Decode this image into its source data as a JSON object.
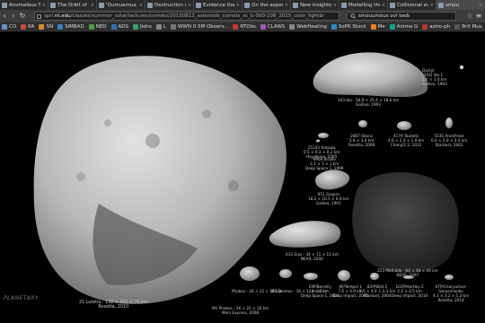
{
  "tabs": [
    {
      "label": "Anomalous T"
    },
    {
      "label": "The Orbit of"
    },
    {
      "label": "'Oumuamua"
    },
    {
      "label": "Destruction o"
    },
    {
      "label": "Evidence that"
    },
    {
      "label": "On the aspect"
    },
    {
      "label": "New insights"
    },
    {
      "label": "Modelling the"
    },
    {
      "label": "Collisional ev"
    },
    {
      "label": "smou"
    }
  ],
  "navbar": {
    "url_prefix": "sprl",
    "url_host": "nt.edu",
    "url_path": "/classes/summer_solar/lectures/comets/20150813_asteroids_comets_sc_b-000-108_2015_color_lightbr",
    "search": "smouumous ovi loeb"
  },
  "bookmarks": [
    {
      "label": "CO",
      "color": "#6a8fc7"
    },
    {
      "label": "KA",
      "color": "#c94a3a"
    },
    {
      "label": "SN",
      "color": "#d18a2f"
    },
    {
      "label": "SIMBAD",
      "color": "#3b7fc4"
    },
    {
      "label": "NED",
      "color": "#4a9a4a"
    },
    {
      "label": "ADS",
      "color": "#2f6fb4"
    },
    {
      "label": "Jisho",
      "color": "#3aa06a"
    },
    {
      "label": "L",
      "color": "#888888"
    },
    {
      "label": "WWN 0.5M Observ...",
      "color": "#777777"
    },
    {
      "label": "RTObs",
      "color": "#c0392b"
    },
    {
      "label": "CLAWS",
      "color": "#9b59b6"
    },
    {
      "label": "WebHeating",
      "color": "#888888"
    },
    {
      "label": "SoPK Stock",
      "color": "#2e86c1"
    },
    {
      "label": "Me",
      "color": "#e67e22"
    },
    {
      "label": "Anime G",
      "color": "#16a085"
    },
    {
      "label": "astro-ph",
      "color": "#b03a2e"
    },
    {
      "label": "Brit Mus",
      "color": "#555555"
    }
  ],
  "captions": {
    "lutetia": "21 Lutetia - 132 × 101 × 76 km\nRosetta, 2010",
    "dactyl": "Dactyl\n(243) Ida 1\n1.6 × 1.4 km\nGalileo, 1993",
    "ida": "243 Ida - 58.8 × 25.4 × 18.6 km\nGalileo, 1993",
    "itokawa": "25143 Itokawa\n0.5 × 0.3 × 0.2 km\nHayabusa, 2005",
    "braille": "9969 Braille\n2.1 × 1 × 1 km\nDeep Space 1, 1999",
    "steins": "2867 Šteins\n5.9 × 4.0 km\nRosetta, 2008",
    "toutatis": "4179 Toutatis\n4.6 × 2.4 × 1.9 km\nChang'E 2, 2012",
    "annefrank": "5535 Annefrank\n6.6 × 5.0 × 3.4 km\nStardust, 2002",
    "gaspra": "951 Gaspra\n18.2 × 10.5 × 8.9 km\nGalileo, 1991",
    "eros": "433 Eros - 34 × 11 × 11 km\nNEAR, 2000",
    "mathilde": "253 Mathilde - 66 × 48 × 44 km\nNEAR, 1997",
    "phobos": "Phobos - 26 × 22 × 18 km",
    "deimos": "M1 Deimos - 16 × 12 × 10 km",
    "borrelly": "19P/Borrelly\n8 × 4 km\nDeep Space 1, 2001",
    "tempel1": "9P/Tempel 1\n7.6 × 4.9 km\nDeep Impact, 2005",
    "wild2": "81P/Wild 2\n5.5 × 4.0 × 3.3 km\nStardust, 2004",
    "hartley2": "103P/Hartley 2\n2.2 × 0.5 km\nDeep Impact, 2010",
    "cg67p": "67P/Churyumov-\nGerasimenko\n4.1 × 3.2 × 1.3 km\nRosetta, 2014",
    "phobos2": "M1 Phobos - 26 × 22 × 18 km\nMars Express, 2008"
  },
  "watermark": "PLANETARY"
}
